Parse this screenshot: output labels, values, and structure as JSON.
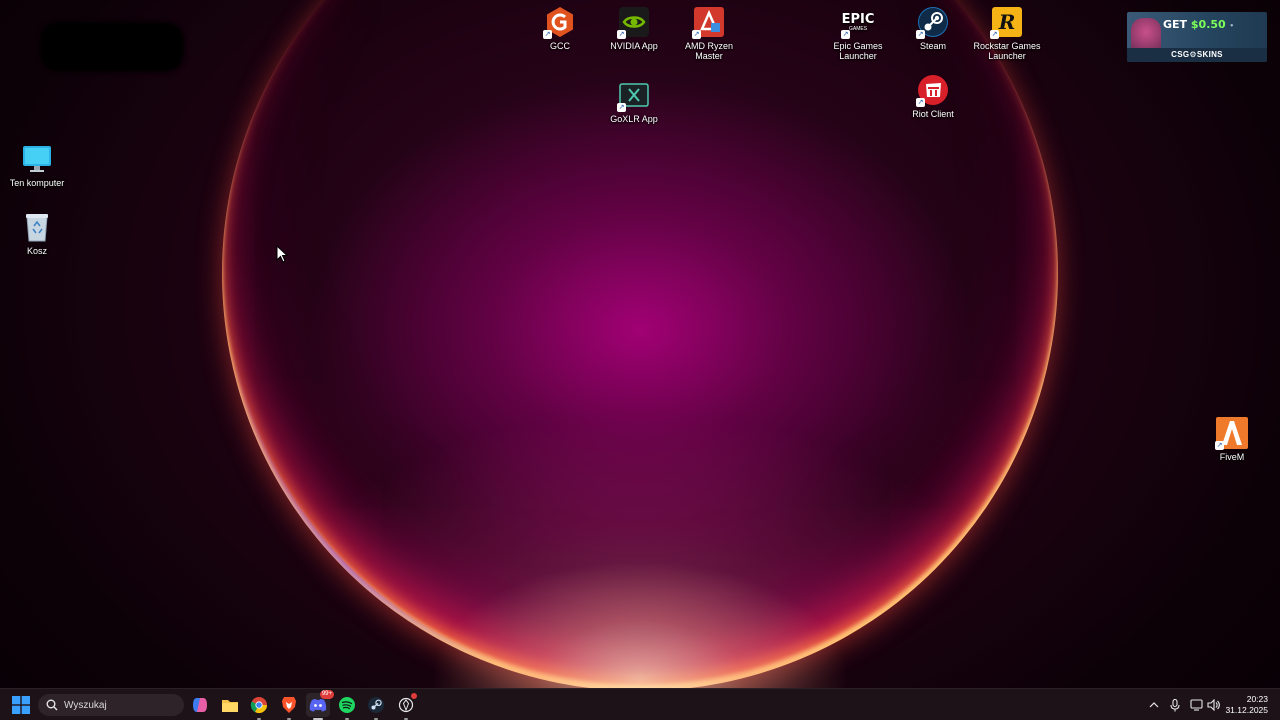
{
  "desktop": {
    "icons": [
      {
        "label": "GCC",
        "icon": "gcc-icon",
        "color": "#e0531f"
      },
      {
        "label": "NVIDIA App",
        "icon": "nvidia-icon",
        "color": "#76b900"
      },
      {
        "label": "AMD Ryzen Master",
        "icon": "amd-ryzen-icon",
        "color": "#d3382c"
      },
      {
        "label": "Epic Games Launcher",
        "icon": "epic-games-icon",
        "icon_text": "EPIC",
        "icon_subtext": "GAMES"
      },
      {
        "label": "Steam",
        "icon": "steam-icon",
        "color": "#1b6fb3"
      },
      {
        "label": "Rockstar Games Launcher",
        "icon": "rockstar-icon",
        "icon_text": "R",
        "color": "#f5b316"
      },
      {
        "label": "GoXLR App",
        "icon": "goxlr-icon"
      },
      {
        "label": "Riot Client",
        "icon": "riot-client-icon",
        "color": "#d7202a"
      },
      {
        "label": "Ten komputer",
        "icon": "this-pc-icon"
      },
      {
        "label": "Kosz",
        "icon": "recycle-bin-icon"
      },
      {
        "label": "FiveM",
        "icon": "fivem-icon",
        "color": "#f07a2b"
      }
    ]
  },
  "ad_banner": {
    "headline": "GET",
    "price": "$0.50",
    "brand": "CSG⚙SKINS"
  },
  "taskbar": {
    "search_placeholder": "Wyszukaj",
    "discord_badge": "99+",
    "pinned": [
      {
        "name": "copilot-icon"
      },
      {
        "name": "file-explorer-icon"
      },
      {
        "name": "chrome-icon"
      },
      {
        "name": "brave-icon"
      },
      {
        "name": "discord-icon"
      },
      {
        "name": "spotify-icon"
      },
      {
        "name": "steam-icon"
      },
      {
        "name": "chatgpt-icon"
      }
    ],
    "clock": {
      "time": "20:23",
      "date": "31.12.2025"
    }
  }
}
